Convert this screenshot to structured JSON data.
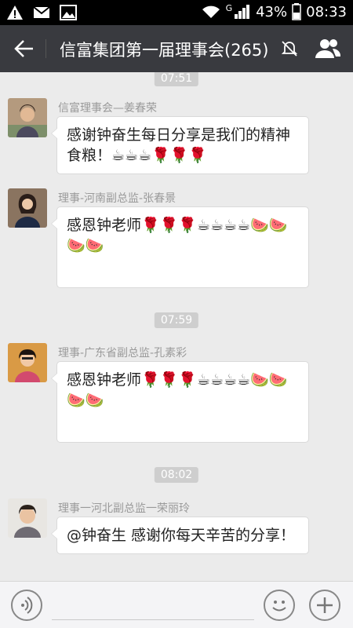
{
  "status_bar": {
    "signal_type": "G",
    "battery": "43%",
    "time": "08:33"
  },
  "header": {
    "title": "信富集团第一届理事会(265)"
  },
  "chat": {
    "messages": [
      {
        "time": "07:51",
        "sender": "信富理事会—姜春荣",
        "text": "感谢钟奋生每日分享是我们的精神食粮！☕☕☕🌹🌹🌹"
      },
      {
        "sender": "理事-河南副总监-张春景",
        "text": "感恩钟老师🌹🌹🌹☕☕☕☕🍉🍉🍉🍉"
      },
      {
        "time": "07:59",
        "sender": "理事-广东省副总监-孔素彩",
        "text": "感恩钟老师🌹🌹🌹☕☕☕☕🍉🍉🍉🍉"
      },
      {
        "time": "08:02",
        "sender": "理事一河北副总监一荣丽玲",
        "text": "@钟奋生 感谢你每天辛苦的分享！"
      }
    ]
  },
  "icons": {
    "alert": "alert-icon",
    "mail": "mail-icon",
    "image": "image-icon",
    "wifi": "wifi-icon",
    "signal": "signal-icon",
    "battery": "battery-icon",
    "back": "back-arrow-icon",
    "mute": "mute-bell-icon",
    "group": "group-members-icon",
    "voice": "voice-icon",
    "emoji": "emoji-icon",
    "plus": "plus-icon"
  },
  "colors": {
    "header_bg": "#393a3f",
    "chat_bg": "#ebebeb",
    "bubble_bg": "#ffffff",
    "time_badge": "#cecece"
  }
}
